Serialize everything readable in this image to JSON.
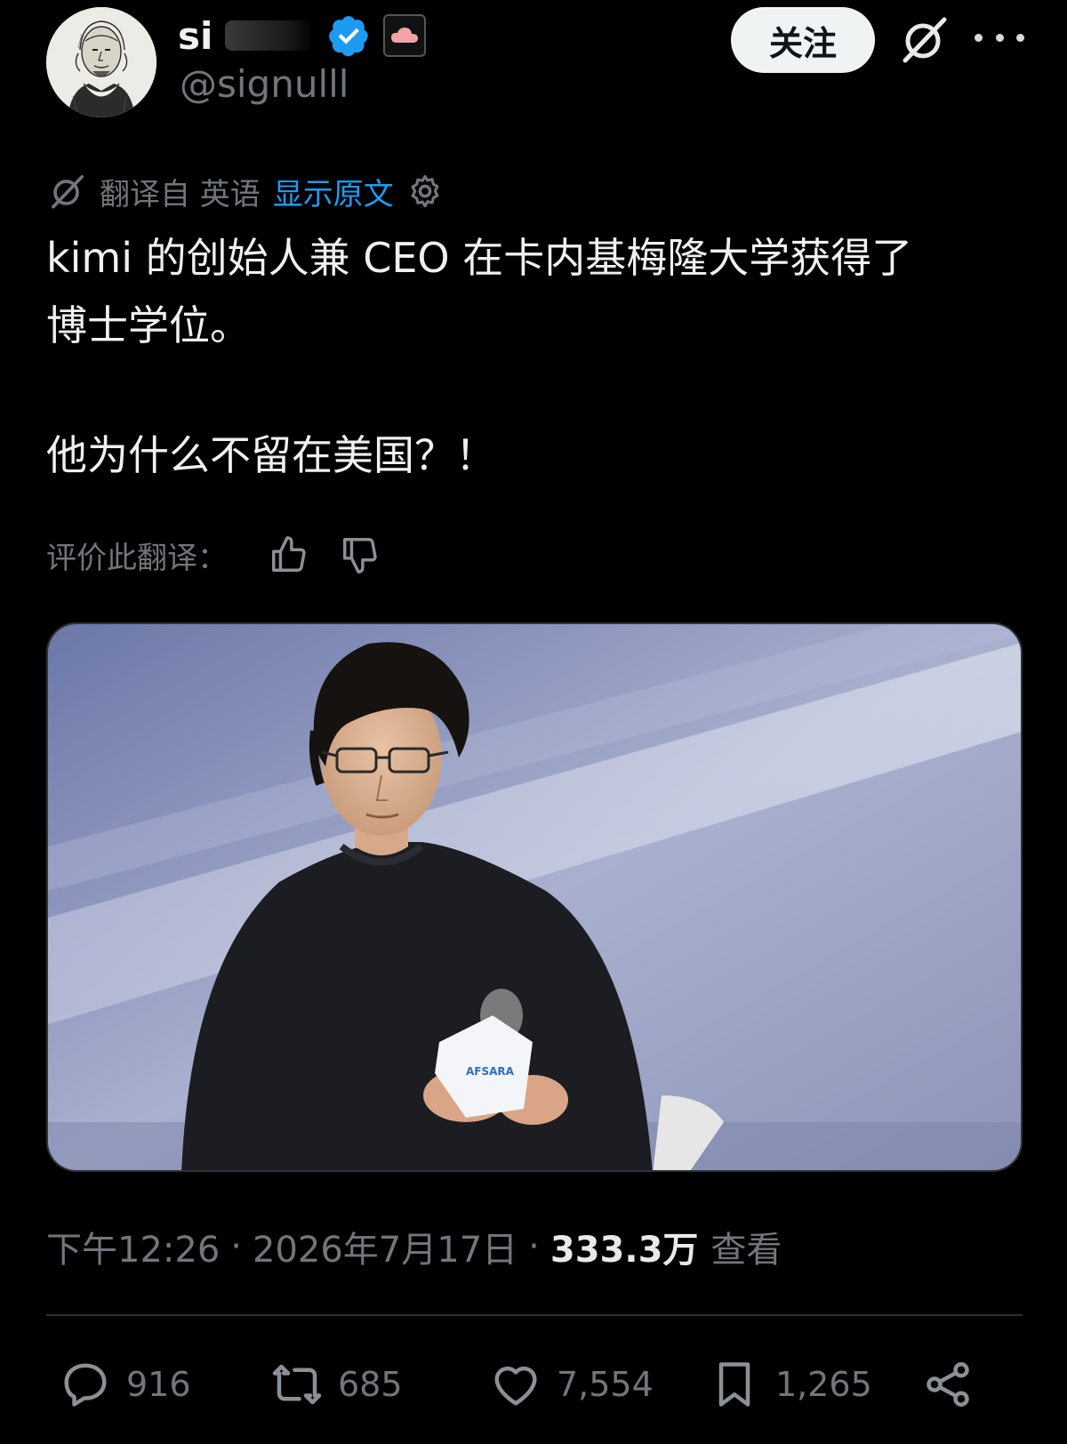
{
  "author": {
    "display_name": "si",
    "handle": "@signulll",
    "verified_icon": "verified-badge-icon",
    "badge_icon": "cloud-affiliate-icon",
    "avatar_icon": "shakespeare-portrait-avatar"
  },
  "header": {
    "follow_label": "关注",
    "grok_icon": "grok-icon",
    "more_icon": "more-icon"
  },
  "translation": {
    "icon": "grok-translate-icon",
    "from_label": "翻译自 英语",
    "show_original": "显示原文",
    "settings_icon": "gear-icon"
  },
  "tweet": {
    "line1": "kimi 的创始人兼 CEO 在卡内基梅隆大学获得了",
    "line2": "博士学位。",
    "line3": "他为什么不留在美国？！"
  },
  "rating": {
    "label": "评价此翻译：",
    "up_icon": "thumbs-up-icon",
    "down_icon": "thumbs-down-icon"
  },
  "media": {
    "mic_label": "AFSARA"
  },
  "meta": {
    "time": "下午12:26",
    "date": "2026年7月17日",
    "views_count": "333.3万",
    "views_label": "查看"
  },
  "actions": {
    "replies": "916",
    "reposts": "685",
    "likes": "7,554",
    "bookmarks": "1,265"
  },
  "colors": {
    "background": "#000000",
    "link_blue": "#1d9bf0",
    "muted": "#71767b",
    "verified_blue": "#1d9bf0"
  }
}
